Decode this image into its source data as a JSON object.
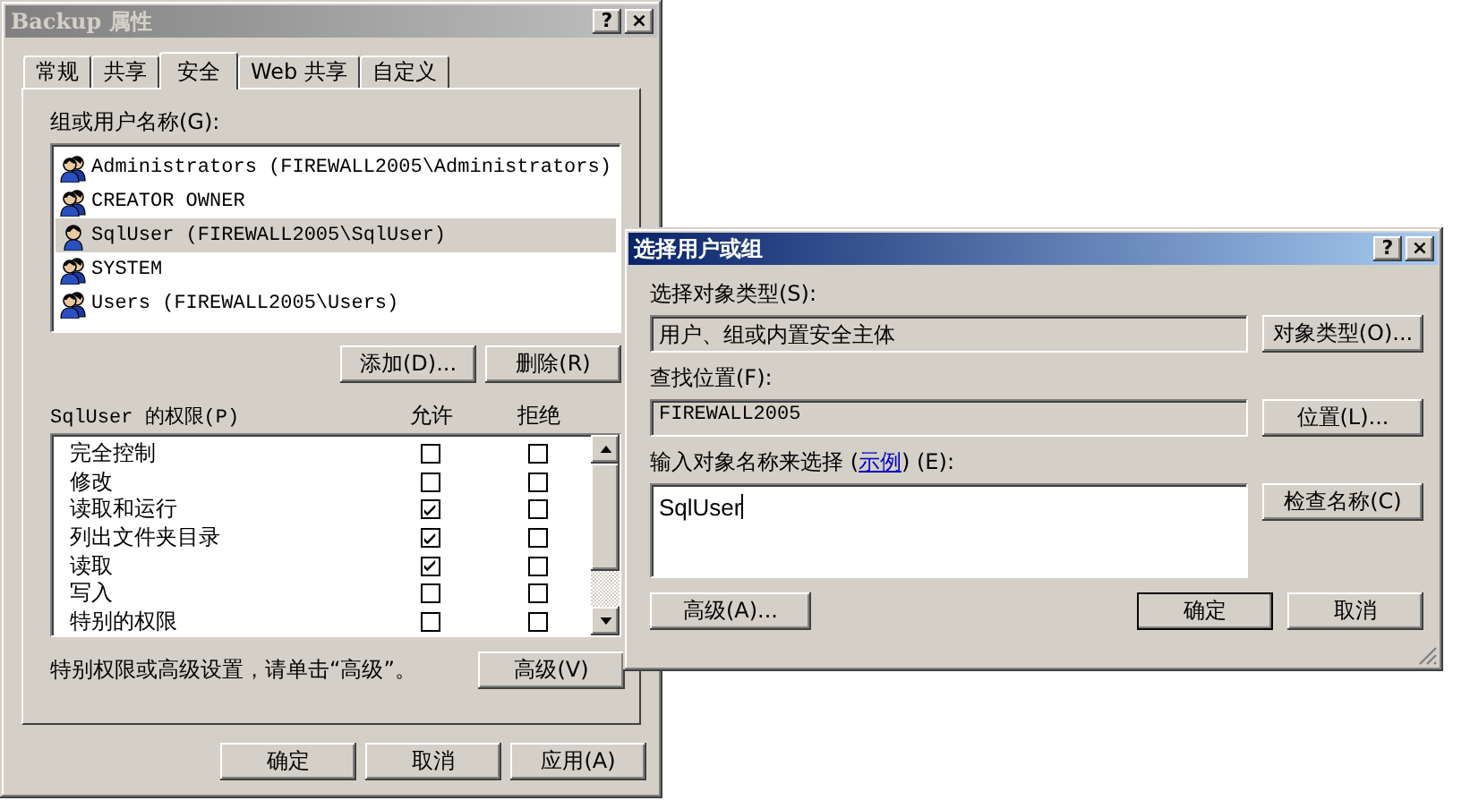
{
  "properties_dialog": {
    "title": "Backup 属性",
    "help_button": "?",
    "close_button": "×",
    "tabs": [
      {
        "label": "常规",
        "selected": false
      },
      {
        "label": "共享",
        "selected": false
      },
      {
        "label": "安全",
        "selected": true
      },
      {
        "label": "Web 共享",
        "selected": false
      },
      {
        "label": "自定义",
        "selected": false
      }
    ],
    "users_label": "组或用户名称(G):",
    "users": [
      {
        "name": "Administrators (FIREWALL2005\\Administrators)",
        "kind": "group",
        "selected": false
      },
      {
        "name": "CREATOR OWNER",
        "kind": "group",
        "selected": false
      },
      {
        "name": "SqlUser (FIREWALL2005\\SqlUser)",
        "kind": "user",
        "selected": true
      },
      {
        "name": "SYSTEM",
        "kind": "group",
        "selected": false
      },
      {
        "name": "Users (FIREWALL2005\\Users)",
        "kind": "group",
        "selected": false
      }
    ],
    "add_button": "添加(D)...",
    "remove_button": "删除(R)",
    "permissions_label": "SqlUser 的权限(P)",
    "allow_header": "允许",
    "deny_header": "拒绝",
    "permissions": [
      {
        "name": "完全控制",
        "allow": false,
        "deny": false
      },
      {
        "name": "修改",
        "allow": false,
        "deny": false
      },
      {
        "name": "读取和运行",
        "allow": true,
        "deny": false
      },
      {
        "name": "列出文件夹目录",
        "allow": true,
        "deny": false
      },
      {
        "name": "读取",
        "allow": true,
        "deny": false
      },
      {
        "name": "写入",
        "allow": false,
        "deny": false
      },
      {
        "name": "特别的权限",
        "allow": false,
        "deny": false
      }
    ],
    "advanced_hint": "特别权限或高级设置，请单击“高级”。",
    "advanced_button": "高级(V)",
    "buttons": [
      "确定",
      "取消",
      "应用(A)"
    ]
  },
  "select_dialog": {
    "title": "选择用户或组",
    "help_button": "?",
    "close_button": "×",
    "object_type_label": "选择对象类型(S):",
    "object_type": "用户、组或内置安全主体",
    "object_type_button": "对象类型(O)...",
    "location_label": "查找位置(F):",
    "location": "FIREWALL2005",
    "location_button": "位置(L)...",
    "names_label_before": "输入对象名称来选择 (",
    "example_link": "示例",
    "names_label_after": ") (E):",
    "names": "SqlUser",
    "check_names_button": "检查名称(C)",
    "advanced_button": "高级(A)...",
    "buttons": [
      "确定",
      "取消"
    ]
  }
}
